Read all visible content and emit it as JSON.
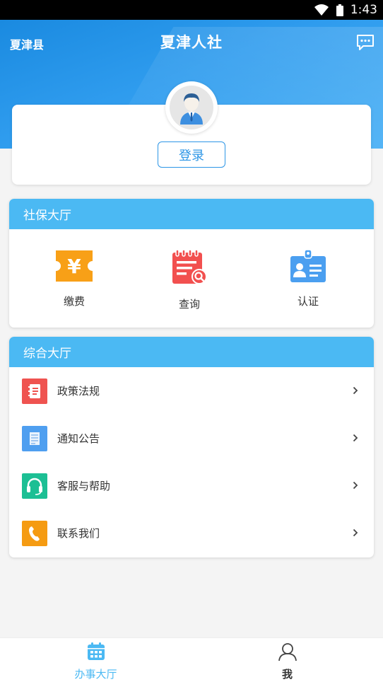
{
  "status_bar": {
    "time": "1:43",
    "wifi_icon": "wifi-icon",
    "battery_icon": "battery-icon"
  },
  "header": {
    "county": "夏津县",
    "title": "夏津人社",
    "message_icon": "message-icon",
    "accent_color": "#2f9cee"
  },
  "profile": {
    "avatar_icon": "user-avatar-icon",
    "login_label": "登录"
  },
  "social_hall": {
    "title": "社保大厅",
    "items": [
      {
        "label": "缴费",
        "icon": "payment-ticket-icon",
        "color": "#f8a017"
      },
      {
        "label": "查询",
        "icon": "search-document-icon",
        "color": "#f2504f"
      },
      {
        "label": "认证",
        "icon": "id-card-icon",
        "color": "#4b9ff0"
      }
    ]
  },
  "general_hall": {
    "title": "综合大厅",
    "items": [
      {
        "label": "政策法规",
        "icon": "policy-book-icon",
        "color": "#ef5350"
      },
      {
        "label": "通知公告",
        "icon": "notice-document-icon",
        "color": "#4f9ff0"
      },
      {
        "label": "客服与帮助",
        "icon": "headset-icon",
        "color": "#1cbf94"
      },
      {
        "label": "联系我们",
        "icon": "phone-icon",
        "color": "#f59b12"
      }
    ]
  },
  "bottom_nav": {
    "tabs": [
      {
        "label": "办事大厅",
        "icon": "calendar-grid-icon",
        "active": true
      },
      {
        "label": "我",
        "icon": "person-icon",
        "active": false
      }
    ]
  }
}
